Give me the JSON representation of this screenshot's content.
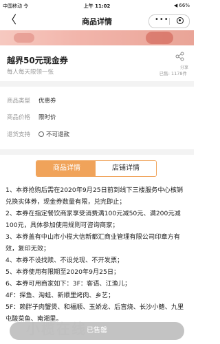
{
  "status_bar": {
    "carrier": "中国移动 令",
    "time": "上午 11:02",
    "battery": "◀ 66%"
  },
  "nav": {
    "back_glyph": "〈",
    "title": "商品详情",
    "menu_glyph": "•••"
  },
  "product": {
    "title": "越界50元现金券",
    "subtitle": "每人每天限领一张",
    "share_label": "分享",
    "sold": "已售: 1178件"
  },
  "info": {
    "type_label": "商品类型",
    "type_value": "优惠券",
    "price_label": "商品价格",
    "price_value": "限时价",
    "refund_label": "退货支持",
    "refund_value": "不可退款"
  },
  "tabs": {
    "detail": "商品详情",
    "shop": "店铺详情"
  },
  "description": {
    "lines": [
      "1、本券抢购后需在2020年9月25日前到线下三楼服务中心核销兑换实体券，现金券数量有限，兑完即止；",
      "2、本券在指定餐饮商家享受消费满100元减50元、满200元减100元，具体参加使用规则可咨询商家；",
      "3、本券盖有中山市小榄大信新都汇商业管理有限公司印章方有效，复印无效；",
      "4、本券不设找赎、不设兑现、不开发票；",
      "5、本券使用有限期至2020年9月25日；",
      "6、本券可用商家如下：3F：客语、江渔儿；",
      "4F：探鱼、淘蛙、新顺里烤肉、乡艺；",
      "5F：赖胖子肉蟹煲、和福顺、玉娇龙、后宫烧、长沙小鳍、九里屯酸菜鱼、南湘里。"
    ]
  },
  "watermark": "小榄在线",
  "footer": {
    "button_label": "已售罄"
  },
  "colors": {
    "accent": "#f0a35a",
    "banner": "#f2b5ab"
  }
}
